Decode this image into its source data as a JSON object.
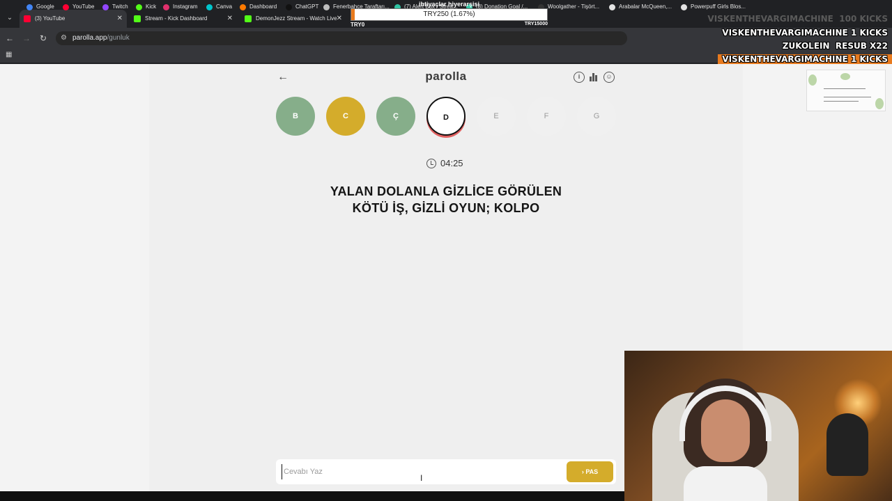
{
  "browser": {
    "tabs": [
      {
        "label": "(3) YouTube",
        "icon": "youtube-icon",
        "color": "#ff0033"
      },
      {
        "label": "Stream - Kick Dashboard",
        "icon": "kick-icon",
        "color": "#53fc18"
      },
      {
        "label": "DemonJezz Stream - Watch Live",
        "icon": "kick-icon",
        "color": "#53fc18"
      }
    ],
    "url_host": "parolla.app",
    "url_path": "/gunluk",
    "bookmarks": [
      {
        "label": "Google",
        "color": "#4285f4"
      },
      {
        "label": "YouTube",
        "color": "#ff0033"
      },
      {
        "label": "Twitch",
        "color": "#9146ff"
      },
      {
        "label": "Kick",
        "color": "#53fc18"
      },
      {
        "label": "Instagram",
        "color": "#e1306c"
      },
      {
        "label": "Canva",
        "color": "#00c4cc"
      },
      {
        "label": "Dashboard",
        "color": "#ff7a00"
      },
      {
        "label": "ChatGPT",
        "color": "#111111"
      },
      {
        "label": "Fenerbahçe Taraftarı...",
        "color": "#bdbdbd"
      },
      {
        "label": "(7) Alert Box / Strea...",
        "color": "#31c3a2"
      },
      {
        "label": "(8) Donation Goal /...",
        "color": "#31c3a2"
      },
      {
        "label": "Woolgather - Tişört...",
        "color": "#333333"
      },
      {
        "label": "Arabalar McQueen,...",
        "color": "#e3e3e3"
      },
      {
        "label": "Powerpuff Girls Blos...",
        "color": "#e3e3e3"
      }
    ]
  },
  "game": {
    "logo": "parolla",
    "letters": [
      {
        "letter": "B",
        "state": "correct",
        "color": "#86ae8a"
      },
      {
        "letter": "C",
        "state": "passed",
        "color": "#d4ac2b"
      },
      {
        "letter": "Ç",
        "state": "correct",
        "color": "#86ae8a"
      },
      {
        "letter": "D",
        "state": "current",
        "color": "#ffffff"
      },
      {
        "letter": "E",
        "state": "empty",
        "color": "#f0f0f0"
      },
      {
        "letter": "F",
        "state": "empty",
        "color": "#f0f0f0"
      },
      {
        "letter": "G",
        "state": "empty",
        "color": "#f0f0f0"
      }
    ],
    "timer": "04:25",
    "question_line1": "YALAN DOLANLA GİZLİCE GÖRÜLEN",
    "question_line2": "KÖTÜ İŞ, GİZLİ OYUN; KOLPO",
    "answer_placeholder": "Cevabı Yaz",
    "pass_label": "PAS",
    "accent": "#d4ac2b"
  },
  "overlay": {
    "goal_title": "ihtiyaçlar hiyerarşisi",
    "goal_value": "TRY250 (1.67%)",
    "goal_fraction": 0.0167,
    "goal_min": "TRY0",
    "goal_max": "TRY15000",
    "alert_1_name": "VISKENTHEVARGIMACHINE",
    "alert_1_count": "100 KICKS",
    "alert_2_name": "VISKENTHEVARGIMACHINE",
    "alert_2_count": "1 KICKS",
    "alert_3_name": "ZUKOLEIN",
    "alert_3_count": "RESUB X22",
    "alert_4_name": "VISKENTHEVARGIMACHINE",
    "alert_4_count": "1 KICKS"
  }
}
